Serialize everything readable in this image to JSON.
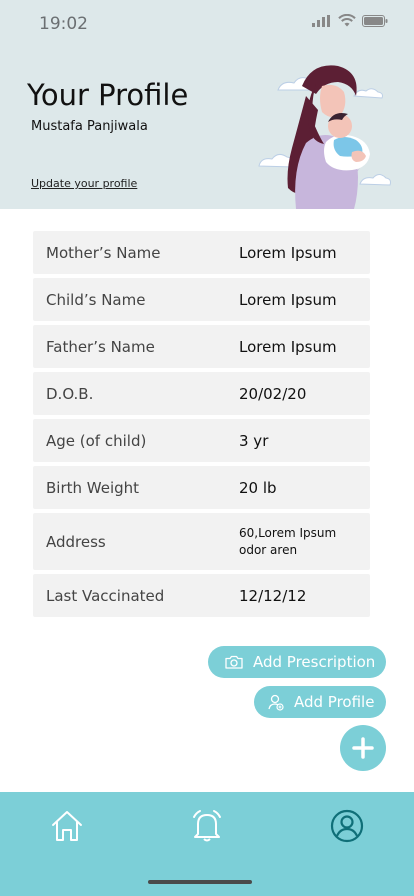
{
  "status_bar": {
    "time": "19:02"
  },
  "header": {
    "title": "Your Profile",
    "username": "Mustafa Panjiwala",
    "update_link": "Update your profile"
  },
  "profile": {
    "rows": [
      {
        "label": "Mother’s Name",
        "value": "Lorem Ipsum"
      },
      {
        "label": "Child’s Name",
        "value": "Lorem Ipsum"
      },
      {
        "label": "Father’s Name",
        "value": "Lorem Ipsum"
      },
      {
        "label": "D.O.B.",
        "value": "20/02/20"
      },
      {
        "label": "Age (of child)",
        "value": "3 yr"
      },
      {
        "label": "Birth Weight",
        "value": "20 lb"
      },
      {
        "label": "Address",
        "value": "60,Lorem Ipsum\nodor aren"
      },
      {
        "label": "Last Vaccinated",
        "value": "12/12/12"
      }
    ]
  },
  "actions": {
    "add_prescription": "Add Prescription",
    "add_profile": "Add Profile"
  },
  "icons": {
    "camera": "camera-icon",
    "add_profile": "add-person-icon",
    "fab": "plus-icon",
    "nav_home": "home-icon",
    "nav_alerts": "bell-icon",
    "nav_profile": "user-circle-icon"
  },
  "colors": {
    "accent": "#7ccfd7",
    "header_bg": "#dde8ea",
    "row_bg": "#f2f2f2"
  }
}
